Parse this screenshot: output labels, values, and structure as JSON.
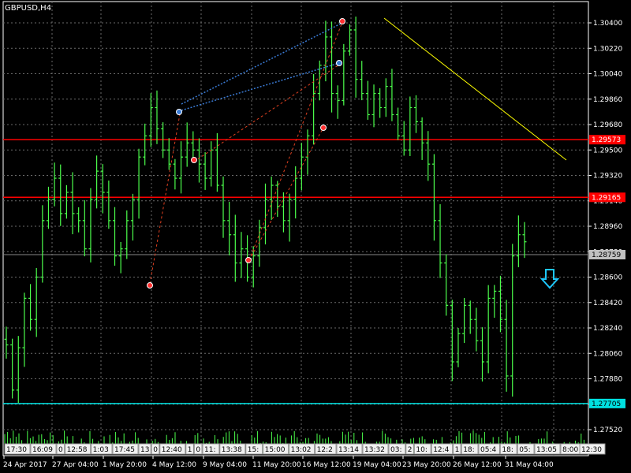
{
  "chart_data": {
    "type": "candlestick",
    "title": "GBPUSD,H4",
    "ylim": [
      1.2734,
      1.3058
    ],
    "y_ticks": [
      "1.30400",
      "1.30220",
      "1.30040",
      "1.29860",
      "1.29680",
      "1.29500",
      "1.29320",
      "1.29140",
      "1.28960",
      "1.28780",
      "1.28600",
      "1.28420",
      "1.28240",
      "1.28060",
      "1.27880",
      "1.27700",
      "1.27520"
    ],
    "x_ticks": [
      "24 Apr 2017",
      "27 Apr 04:00",
      "1 May 20:00",
      "4 May 12:00",
      "9 May 04:00",
      "11 May 20:00",
      "16 May 12:00",
      "19 May 04:00",
      "23 May 20:00",
      "26 May 12:00",
      "31 May 04:00"
    ],
    "close_series": [
      1.2812,
      1.278,
      1.281,
      1.2845,
      1.283,
      1.286,
      1.29,
      1.2915,
      1.293,
      1.2905,
      1.292,
      1.2905,
      1.29,
      1.288,
      1.2915,
      1.2935,
      1.292,
      1.29,
      1.2875,
      1.288,
      1.29,
      1.2915,
      1.2945,
      1.296,
      1.298,
      1.2965,
      1.295,
      1.294,
      1.293,
      1.2945,
      1.2955,
      1.295,
      1.294,
      1.293,
      1.295,
      1.2925,
      1.29,
      1.289,
      1.287,
      1.288,
      1.286,
      1.2875,
      1.2895,
      1.2915,
      1.2925,
      1.291,
      1.29,
      1.2915,
      1.293,
      1.2945,
      1.296,
      1.299,
      1.301,
      1.303,
      1.299,
      1.2985,
      1.302,
      1.3035,
      1.3,
      1.299,
      1.2975,
      1.299,
      1.298,
      1.2995,
      1.2975,
      1.296,
      1.295,
      1.298,
      1.297,
      1.2955,
      1.294,
      1.29,
      1.287,
      1.284,
      1.28,
      1.282,
      1.284,
      1.283,
      1.2815,
      1.28,
      1.2845,
      1.285,
      1.283,
      1.279,
      1.2875,
      1.289,
      1.2885
    ],
    "price_lines": [
      {
        "label": "1.29573",
        "value": 1.29573,
        "color": "#ff0000"
      },
      {
        "label": "1.29165",
        "value": 1.29165,
        "color": "#ff0000"
      },
      {
        "label": "1.27705",
        "value": 1.27705,
        "color": "#00e0e0"
      }
    ],
    "current_price": {
      "label": "1.28759",
      "value": 1.28759
    },
    "bar_color": "#4cff4c",
    "trendline_color": "#ffff00",
    "arrow_color": "#1ec8ff"
  },
  "time_labels": [
    "17:30",
    "16:09",
    "0",
    "12:58",
    "1:03",
    "17:45",
    "13",
    "0",
    "12:40",
    "1",
    "0",
    "11:",
    "13:38",
    "15:",
    "15:00",
    "13:02",
    "12:2",
    "13:14",
    "13:32",
    "03:",
    "2",
    "10:",
    "12:4",
    "1",
    "18:",
    "05:4",
    "18:",
    "05:",
    "13:05",
    "8:00",
    "12:30"
  ]
}
